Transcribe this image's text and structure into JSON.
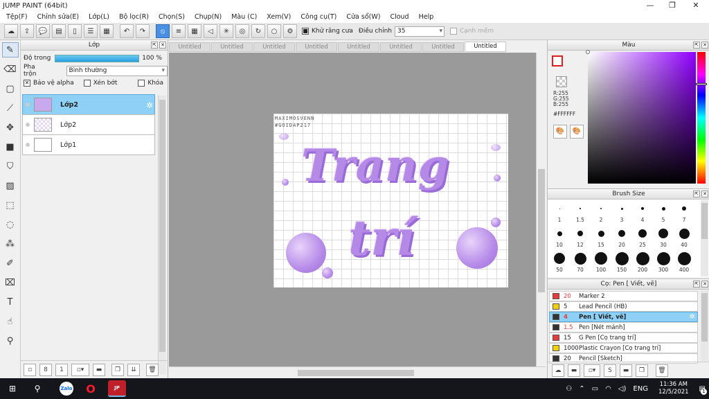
{
  "window": {
    "title": "JUMP PAINT (64bit)",
    "controls": {
      "minimize": "—",
      "maximize": "❐",
      "close": "✕"
    }
  },
  "menu": [
    "Tệp(F)",
    "Chỉnh sửa(E)",
    "Lớp(L)",
    "Bộ lọc(R)",
    "Chọn(S)",
    "Chụp(N)",
    "Màu (C)",
    "Xem(V)",
    "Công cụ(T)",
    "Cửa sổ(W)",
    "Cloud",
    "Help"
  ],
  "toolbar": {
    "antialias_label": "Khử răng cưa",
    "adjust_label": "Điều chỉnh",
    "adjust_value": "35",
    "edge_label": "Cạnh mềm"
  },
  "layer_panel": {
    "title": "Lớp",
    "opacity_label": "Độ trong",
    "opacity_value": "100 %",
    "opacity_fraction": 1.0,
    "blend_label": "Pha trộn",
    "blend_value": "Bình thường",
    "protect_alpha": "Bảo vệ alpha",
    "clipping": "Xén bớt",
    "lock": "Khóa",
    "layers": [
      {
        "name": "Lớp2",
        "selected": true
      },
      {
        "name": "Lớp2",
        "selected": false
      },
      {
        "name": "Lớp1",
        "selected": false
      }
    ]
  },
  "tabs": [
    "Untitled",
    "Untitled",
    "Untitled",
    "Untitled",
    "Untitled",
    "Untitled",
    "Untitled",
    "Untitled"
  ],
  "artwork": {
    "credit_line1": "MAXIMOSVENN",
    "credit_line2": "#GOIDAP217",
    "word1": "Trang",
    "word2": "trí"
  },
  "color_panel": {
    "title": "Màu",
    "r": "R:255",
    "g": "G:255",
    "b": "B:255",
    "hex": "#FFFFFF"
  },
  "brush_panel": {
    "title": "Brush Size",
    "sizes": [
      "1",
      "1.5",
      "2",
      "3",
      "4",
      "5",
      "7",
      "10",
      "12",
      "15",
      "20",
      "25",
      "30",
      "40",
      "50",
      "70",
      "100",
      "150",
      "200",
      "300",
      "400"
    ]
  },
  "tool_panel": {
    "title": "Cọ: Pen [ Viết, vẽ]",
    "items": [
      {
        "size": "20",
        "name": "Marker 2",
        "color": "#e83a3a"
      },
      {
        "size": "5",
        "name": "Lead Pencil (HB)",
        "color": "#f0d000"
      },
      {
        "size": "4",
        "name": "Pen [ Viết, vẽ]",
        "color": "#333333",
        "selected": true
      },
      {
        "size": "1.5",
        "name": "Pen [Nét mảnh]",
        "color": "#333333"
      },
      {
        "size": "15",
        "name": "G Pen [Cọ trang trí]",
        "color": "#e83a3a"
      },
      {
        "size": "1000",
        "name": "Plastic Crayon [Cọ trang trí]",
        "color": "#f0d000"
      },
      {
        "size": "20",
        "name": "Pencil [Sketch]",
        "color": "#333333"
      }
    ]
  },
  "taskbar": {
    "apps": [
      "Zalo",
      "Opera",
      "JUMP PAINT"
    ],
    "lang": "ENG",
    "time": "11:36 AM",
    "date": "12/5/2021",
    "notifications": "1"
  }
}
